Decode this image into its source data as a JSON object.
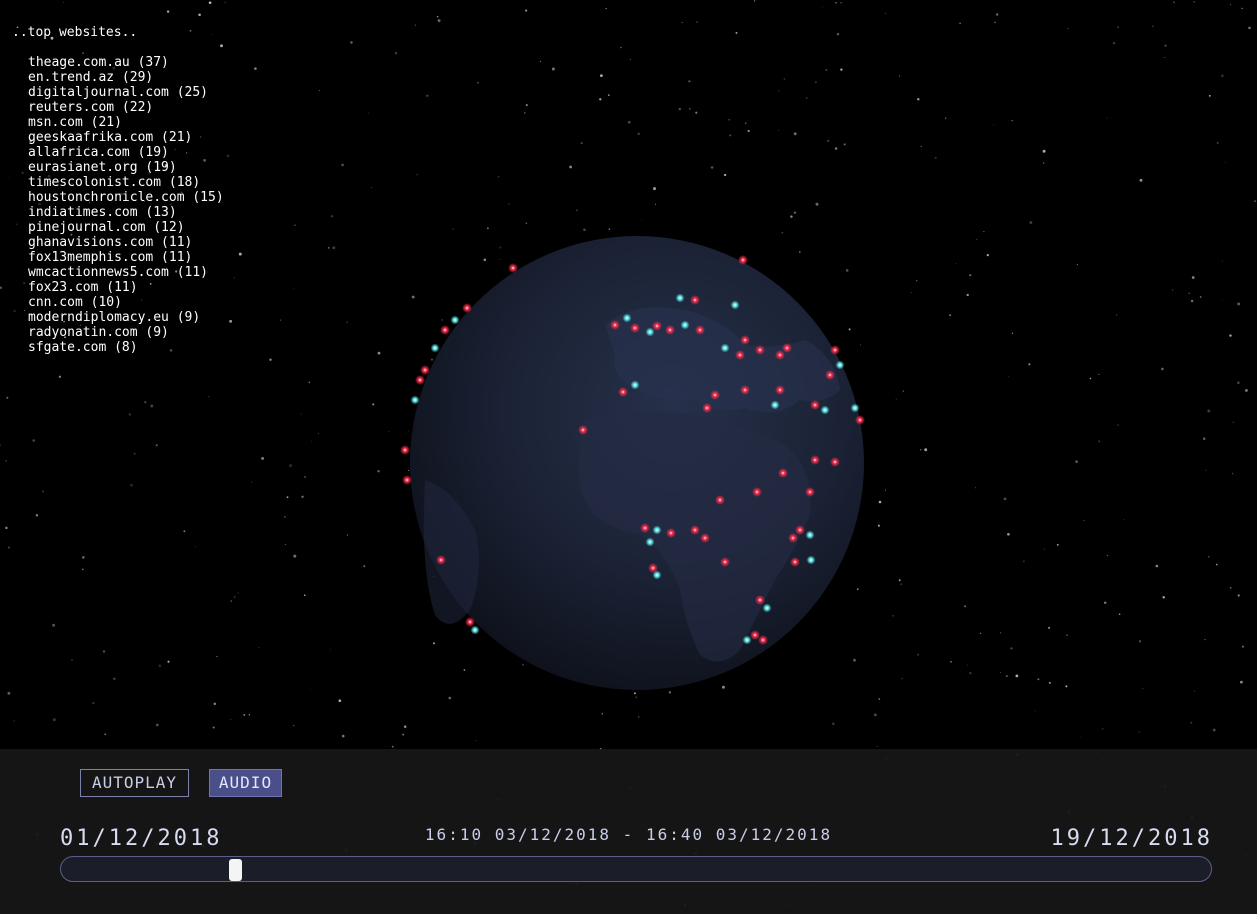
{
  "top_websites": {
    "heading": "..top websites..",
    "items": [
      "theage.com.au (37)",
      "en.trend.az (29)",
      "digitaljournal.com (25)",
      "reuters.com (22)",
      "msn.com (21)",
      "geeskaafrika.com (21)",
      "allafrica.com (19)",
      "eurasianet.org (19)",
      "timescolonist.com (18)",
      "houstonchronicle.com (15)",
      "indiatimes.com (13)",
      "pinejournal.com (12)",
      "ghanavisions.com (11)",
      "fox13memphis.com (11)",
      "wmcactionnews5.com (11)",
      "fox23.com (11)",
      "cnn.com (10)",
      "moderndiplomacy.eu (9)",
      "radyonatin.com (9)",
      "sfgate.com (8)"
    ]
  },
  "controls": {
    "autoplay_label": "AUTOPLAY",
    "audio_label": "AUDIO",
    "start_date": "01/12/2018",
    "end_date": "19/12/2018",
    "current_range": "16:10 03/12/2018 - 16:40 03/12/2018",
    "timeline_position": 0.148
  },
  "colors": {
    "background": "#000000",
    "globe": "#1b1d2b",
    "marker_red": "#ff2a4a",
    "marker_cyan": "#5ff0ee",
    "accent": "#4a4f8a"
  }
}
